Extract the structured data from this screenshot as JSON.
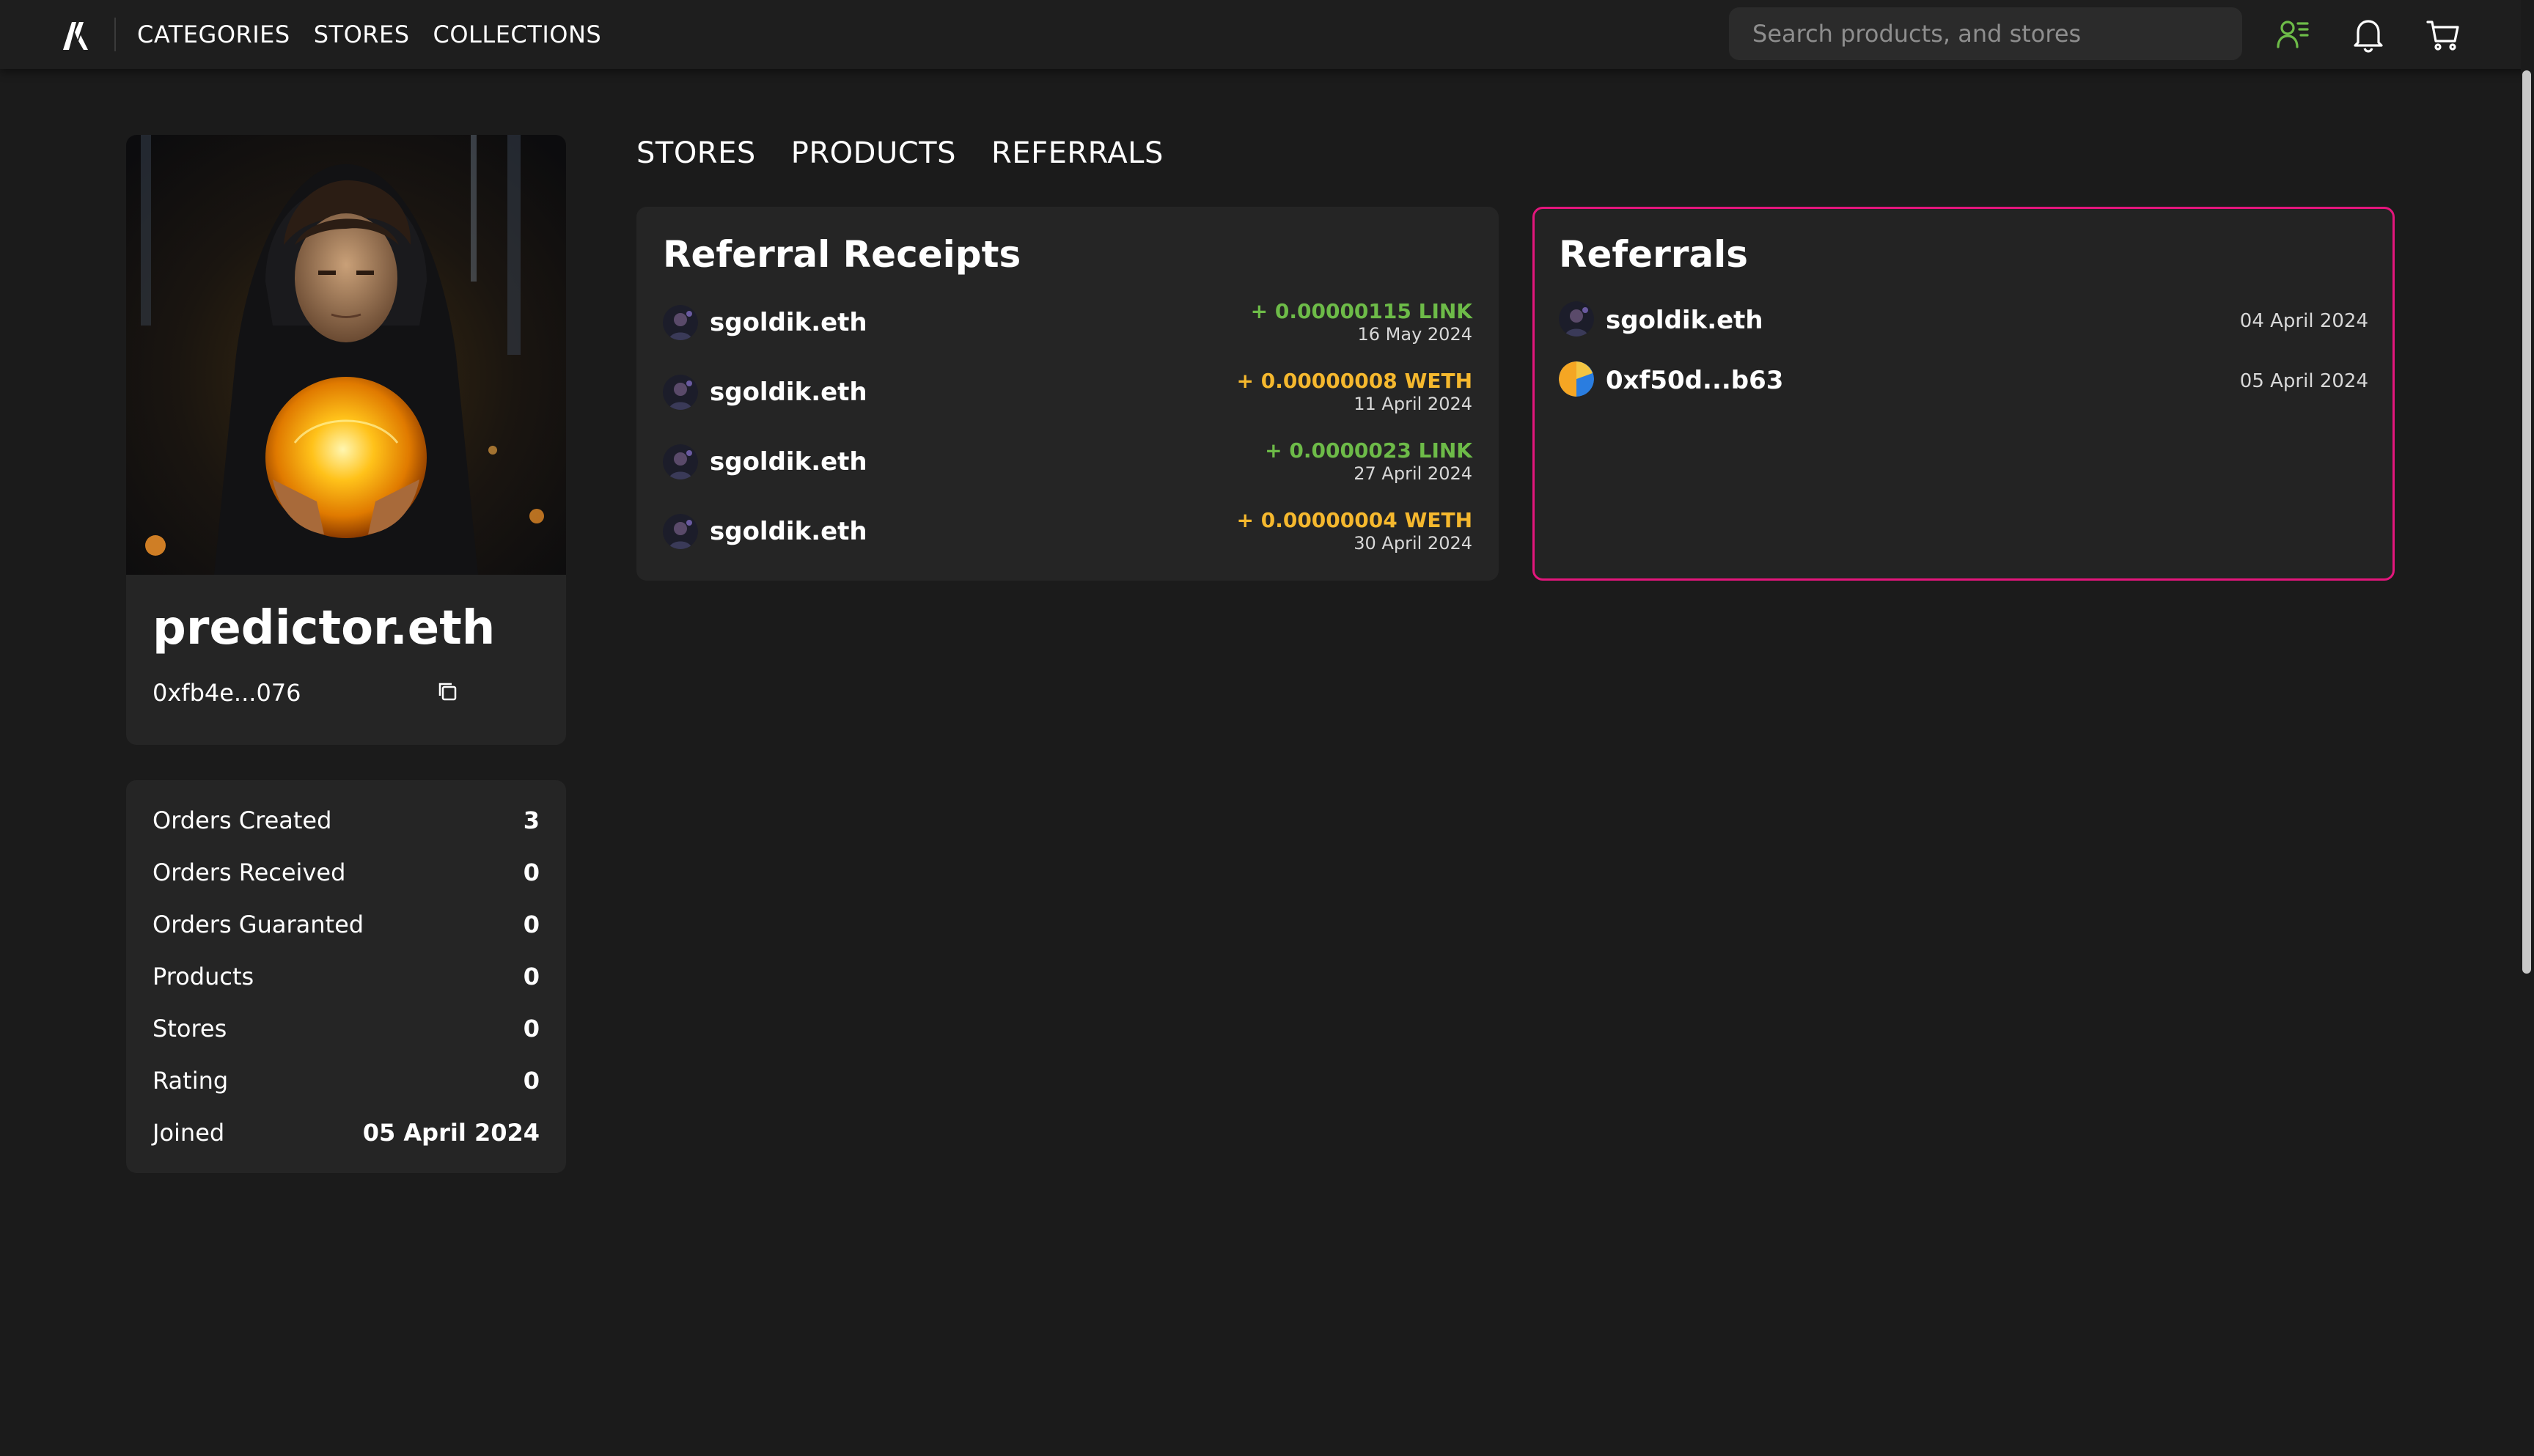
{
  "header": {
    "nav": [
      "CATEGORIES",
      "STORES",
      "COLLECTIONS"
    ],
    "search_placeholder": "Search products, and stores",
    "profile_icon_color": "#6dbb48"
  },
  "profile": {
    "name": "predictor.eth",
    "address": "0xfb4e...076"
  },
  "stats": [
    {
      "label": "Orders Created",
      "value": "3"
    },
    {
      "label": "Orders Received",
      "value": "0"
    },
    {
      "label": "Orders Guaranted",
      "value": "0"
    },
    {
      "label": "Products",
      "value": "0"
    },
    {
      "label": "Stores",
      "value": "0"
    },
    {
      "label": "Rating",
      "value": "0"
    },
    {
      "label": "Joined",
      "value": "05 April 2024"
    }
  ],
  "tabs": [
    "STORES",
    "PRODUCTS",
    "REFERRALS"
  ],
  "receipts": {
    "title": "Referral Receipts",
    "rows": [
      {
        "name": "sgoldik.eth",
        "amount": "+ 0.00000115 LINK",
        "date": "16 May 2024",
        "token": "link"
      },
      {
        "name": "sgoldik.eth",
        "amount": "+ 0.00000008 WETH",
        "date": "11 April 2024",
        "token": "weth"
      },
      {
        "name": "sgoldik.eth",
        "amount": "+ 0.0000023 LINK",
        "date": "27 April 2024",
        "token": "link"
      },
      {
        "name": "sgoldik.eth",
        "amount": "+ 0.00000004 WETH",
        "date": "30 April 2024",
        "token": "weth"
      }
    ]
  },
  "referrals": {
    "title": "Referrals",
    "accent": "#e3167c",
    "rows": [
      {
        "name": "sgoldik.eth",
        "date": "04 April 2024"
      },
      {
        "name": "0xf50d...b63",
        "date": "05 April 2024"
      }
    ]
  },
  "colors": {
    "link": "#6dbb48",
    "weth": "#f5b82e",
    "background": "#1b1b1b",
    "card": "#252525"
  }
}
